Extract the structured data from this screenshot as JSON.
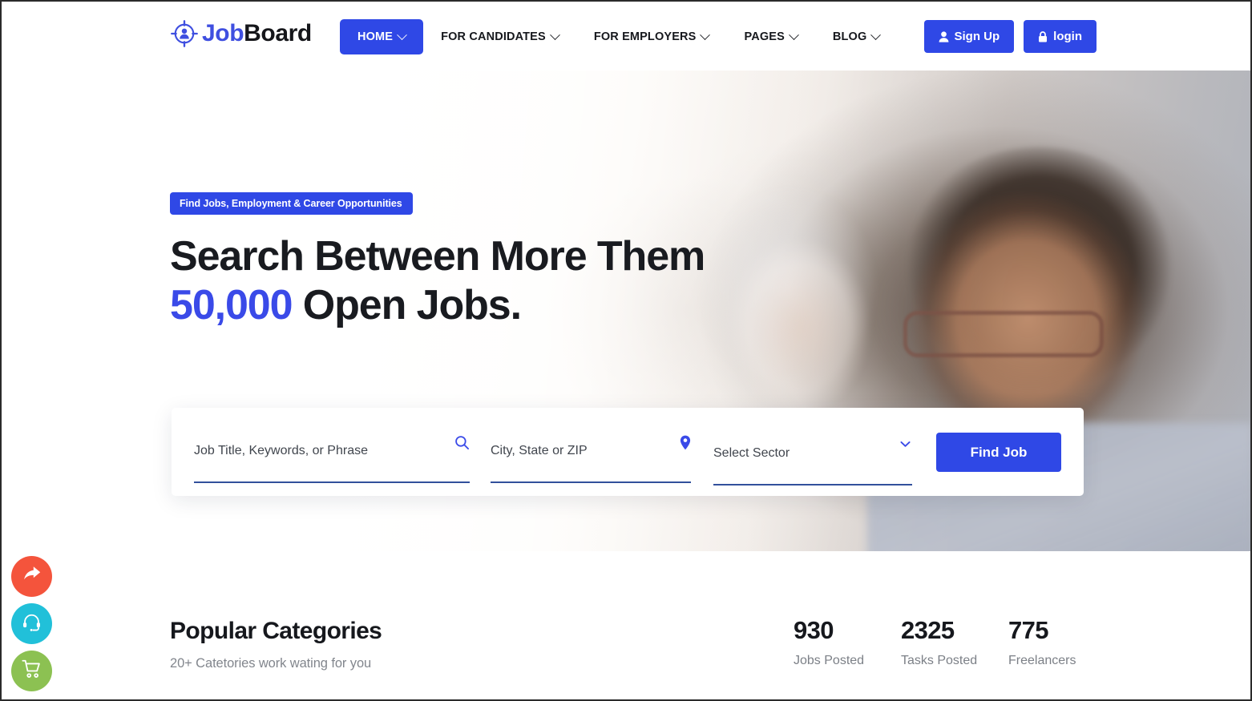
{
  "brand": {
    "logo_icon": "target-person-icon",
    "name_part1": "Job",
    "name_part2": "Board",
    "primary_color": "#2f48e6",
    "accent_color": "#3a4ae8"
  },
  "nav": {
    "items": [
      {
        "label": "HOME",
        "has_caret": true,
        "active": true
      },
      {
        "label": "FOR CANDIDATES",
        "has_caret": true,
        "active": false
      },
      {
        "label": "FOR EMPLOYERS",
        "has_caret": true,
        "active": false
      },
      {
        "label": "PAGES",
        "has_caret": true,
        "active": false
      },
      {
        "label": "BLOG",
        "has_caret": true,
        "active": false
      }
    ]
  },
  "header_actions": {
    "signup_label": "Sign Up",
    "signup_icon": "user-icon",
    "login_label": "login",
    "login_icon": "lock-icon"
  },
  "hero": {
    "badge": "Find Jobs, Employment & Career Opportunities",
    "title_line1": "Search Between More Them",
    "title_highlight": "50,000",
    "title_line2_rest": " Open Jobs."
  },
  "search": {
    "keyword_placeholder": "Job Title, Keywords, or Phrase",
    "keyword_value": "",
    "keyword_icon": "search-icon",
    "location_placeholder": "City, State or ZIP",
    "location_value": "",
    "location_icon": "map-pin-icon",
    "sector_selected": "Select Sector",
    "sector_icon": "chevron-down-icon",
    "sector_options": [
      "Select Sector"
    ],
    "submit_label": "Find Job"
  },
  "categories": {
    "title": "Popular Categories",
    "subtitle": "20+ Catetories work wating for you"
  },
  "stats": [
    {
      "number": "930",
      "label": "Jobs Posted"
    },
    {
      "number": "2325",
      "label": "Tasks Posted"
    },
    {
      "number": "775",
      "label": "Freelancers"
    }
  ],
  "floating_buttons": [
    {
      "icon": "share-arrow-icon",
      "color": "#f4543c"
    },
    {
      "icon": "headset-support-icon",
      "color": "#21c0d9"
    },
    {
      "icon": "shopping-cart-icon",
      "color": "#8cc152"
    }
  ]
}
